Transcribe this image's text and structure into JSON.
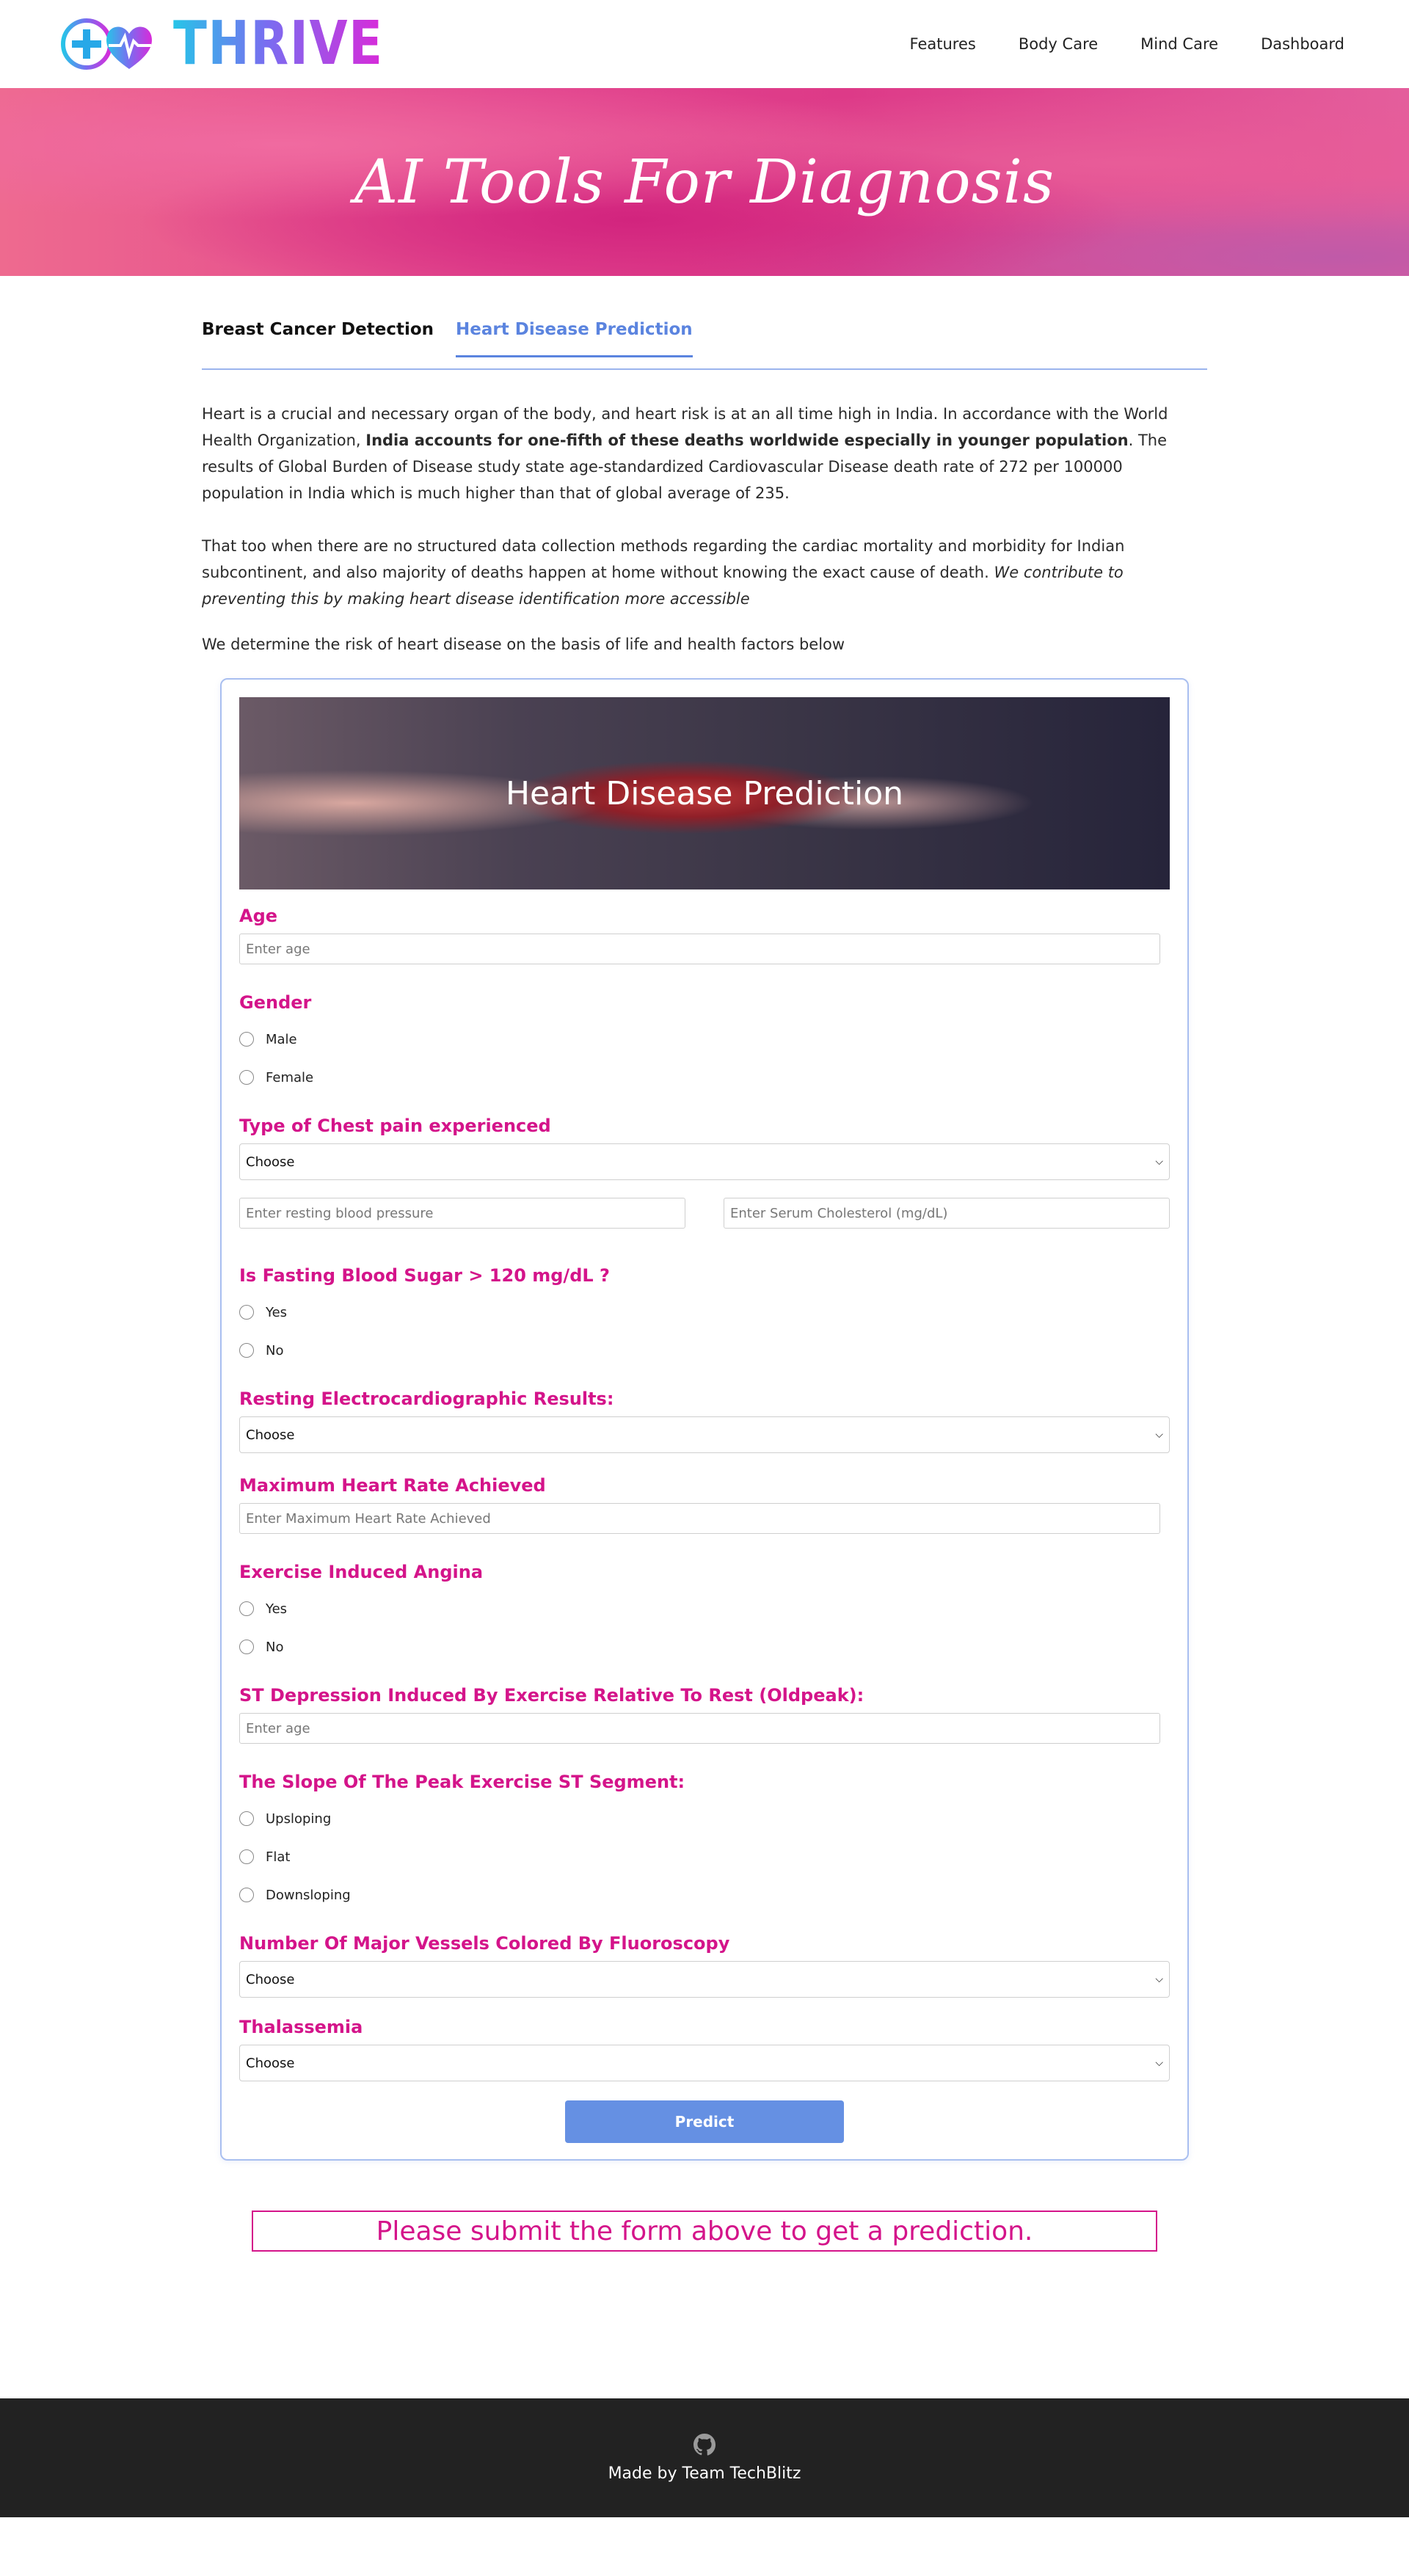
{
  "nav": {
    "brand": "THRIVE",
    "menu": [
      "Features",
      "Body Care",
      "Mind Care",
      "Dashboard"
    ]
  },
  "hero": {
    "title": "AI Tools For Diagnosis"
  },
  "tabs": [
    "Breast Cancer Detection",
    "Heart Disease Prediction"
  ],
  "intro": {
    "p1_a": "Heart is a crucial and necessary organ of the body, and heart risk is at an all time high in India. In accordance with the World Health Organization, ",
    "p1_bold": "India accounts for one-fifth of these deaths worldwide especially in younger population",
    "p1_b": ". The results of Global Burden of Disease study state age-standardized Cardiovascular Disease death rate of 272 per 100000 population in India which is much higher than that of global average of 235.",
    "p2_a": "That too when there are no structured data collection methods regarding the cardiac mortality and morbidity for Indian subcontinent, and also majority of deaths happen at home without knowing the exact cause of death. ",
    "p2_italic": "We contribute to preventing this by making heart disease identification more accessible",
    "p3": "We determine the risk of heart disease on the basis of life and health factors below"
  },
  "form": {
    "banner_title": "Heart Disease Prediction",
    "age": {
      "label": "Age",
      "placeholder": "Enter age"
    },
    "gender": {
      "label": "Gender",
      "options": [
        "Male",
        "Female"
      ]
    },
    "chest_pain": {
      "label": "Type of Chest pain experienced",
      "value": "Choose"
    },
    "bp_placeholder": "Enter resting blood pressure",
    "chol_placeholder": "Enter Serum Cholesterol (mg/dL)",
    "fbs": {
      "label": "Is Fasting Blood Sugar > 120 mg/dL ?",
      "options": [
        "Yes",
        "No"
      ]
    },
    "ecg": {
      "label": "Resting Electrocardiographic Results:",
      "value": "Choose"
    },
    "max_hr": {
      "label": "Maximum Heart Rate Achieved",
      "placeholder": "Enter Maximum Heart Rate Achieved"
    },
    "angina": {
      "label": "Exercise Induced Angina",
      "options": [
        "Yes",
        "No"
      ]
    },
    "oldpeak": {
      "label": "ST Depression Induced By Exercise Relative To Rest (Oldpeak):",
      "placeholder": "Enter age"
    },
    "slope": {
      "label": "The Slope Of The Peak Exercise ST Segment:",
      "options": [
        "Upsloping",
        "Flat",
        "Downsloping"
      ]
    },
    "vessels": {
      "label": "Number Of Major Vessels Colored By Fluoroscopy",
      "value": "Choose"
    },
    "thal": {
      "label": "Thalassemia",
      "value": "Choose"
    },
    "submit": "Predict"
  },
  "result": "Please submit the form above to get a prediction.",
  "footer": {
    "credit": "Made by Team TechBlitz",
    "icon": "github-icon"
  },
  "colors": {
    "accent_pink": "#d4148a",
    "accent_blue": "#5b84df",
    "footer_bg": "#222222"
  }
}
